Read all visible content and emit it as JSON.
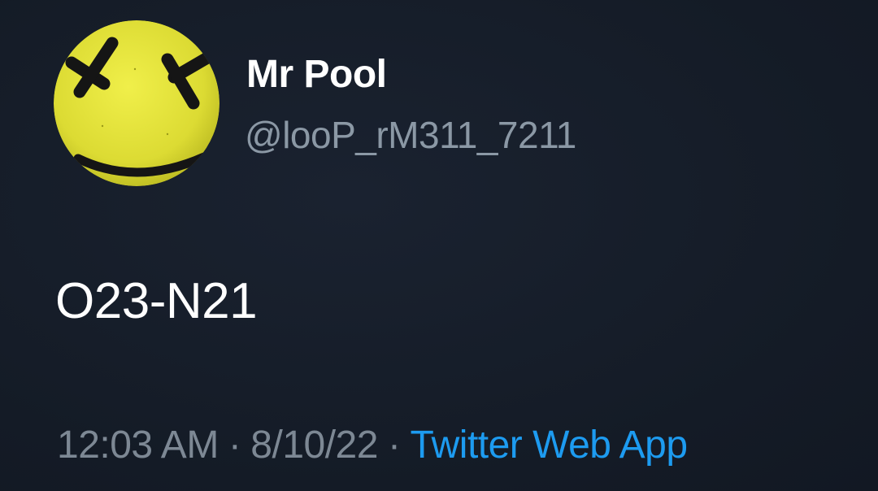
{
  "tweet": {
    "author": {
      "display_name": "Mr Pool",
      "handle": "@looP_rM311_7211",
      "avatar_icon": "yellow-x-eyes-smiley-avatar",
      "avatar_color": "#e6e53a"
    },
    "text": "O23-N21",
    "meta": {
      "time": "12:03 AM",
      "separator": "·",
      "date": "8/10/22",
      "source": "Twitter Web App"
    }
  },
  "colors": {
    "background": "#151c27",
    "text_primary": "#ffffff",
    "text_secondary": "#8b98a5",
    "link": "#1d9bf0"
  }
}
